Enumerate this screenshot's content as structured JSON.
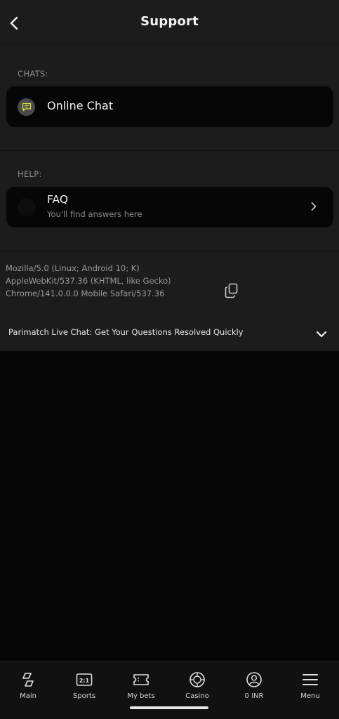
{
  "header": {
    "title": "Support",
    "back_icon": "chevron-left-icon"
  },
  "chats": {
    "label": "CHATS:",
    "online_chat": {
      "label": "Online Chat",
      "icon": "chat-bubble-icon",
      "icon_color": "#d8e23a"
    }
  },
  "help": {
    "label": "HELP:",
    "faq": {
      "title": "FAQ",
      "subtitle": "You'll find answers here",
      "icon": "chevron-right-icon"
    }
  },
  "device_info": {
    "user_agent": "Mozilla/5.0 (Linux; Android 10; K) AppleWebKit/537.36 (KHTML, like Gecko) Chrome/141.0.0.0 Mobile Safari/537.36",
    "copy_icon": "copy-icon"
  },
  "faq_accordion": {
    "title": "Parimatch Live Chat: Get Your Questions Resolved Quickly",
    "icon": "chevron-down-icon"
  },
  "bottom_nav": [
    {
      "label": "Main",
      "icon": "main-icon"
    },
    {
      "label": "Sports",
      "icon": "sports-scoreboard-icon",
      "icon_text": "2:1"
    },
    {
      "label": "My bets",
      "icon": "ticket-icon"
    },
    {
      "label": "Casino",
      "icon": "casino-chip-icon"
    },
    {
      "label": "0 INR",
      "icon": "user-icon"
    },
    {
      "label": "Menu",
      "icon": "menu-icon"
    }
  ],
  "colors": {
    "background": "#050505",
    "panel": "#1c1c1c",
    "card": "#060606",
    "accent": "#d8e23a"
  }
}
